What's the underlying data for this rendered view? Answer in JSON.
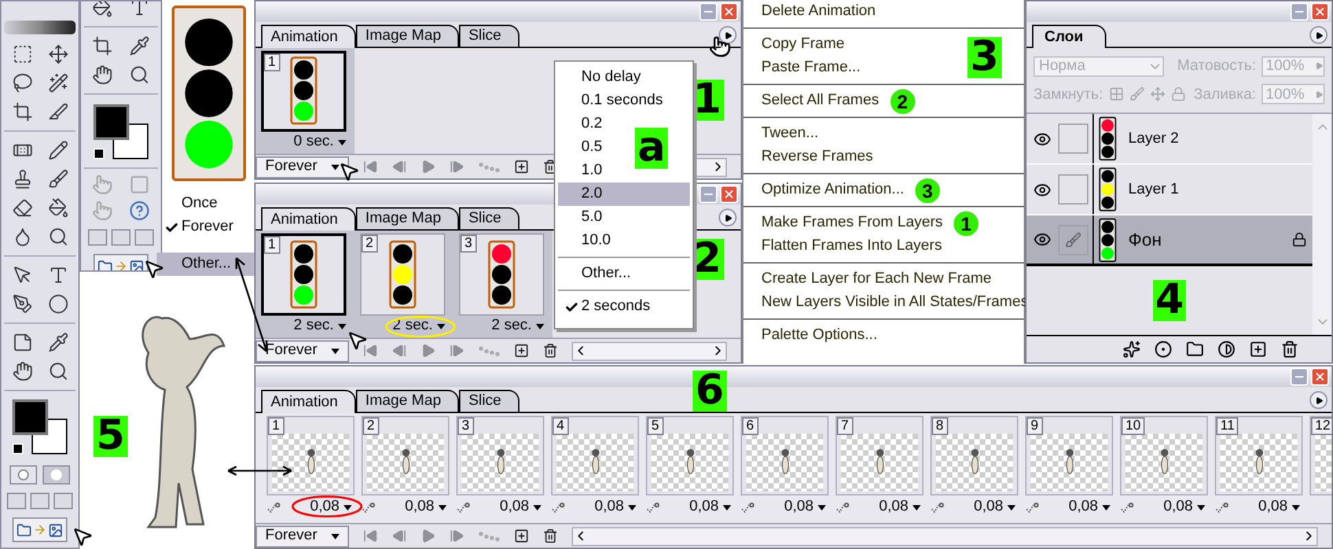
{
  "loop_menu": {
    "preview": {
      "lights": [
        {
          "color": "#000000"
        },
        {
          "color": "#000000"
        },
        {
          "color": "#00ff00"
        }
      ]
    },
    "items": [
      {
        "label": "Once",
        "checked": false,
        "selected": false
      },
      {
        "label": "Forever",
        "checked": true,
        "selected": false
      },
      {
        "label": "Other...",
        "checked": false,
        "selected": true
      }
    ]
  },
  "rabbit": {
    "callout": "5"
  },
  "animation_panels": [
    {
      "callout": "1",
      "loop": "Forever",
      "tabs": [
        {
          "label": "Animation",
          "selected": true
        },
        {
          "label": "Image Map",
          "selected": false
        },
        {
          "label": "Slice",
          "selected": false
        }
      ],
      "frames": [
        {
          "kind": "traffic_light",
          "number": "1",
          "delay": "0 sec.",
          "selected": true,
          "circled": false,
          "lights": [
            {
              "color": "#000000"
            },
            {
              "color": "#000000"
            },
            {
              "color": "#00ff00"
            }
          ]
        }
      ]
    },
    {
      "callout": "2",
      "loop": "Forever",
      "tabs": [
        {
          "label": "Animation",
          "selected": true
        },
        {
          "label": "Image Map",
          "selected": false
        },
        {
          "label": "Slice",
          "selected": false
        }
      ],
      "frames": [
        {
          "kind": "traffic_light",
          "number": "1",
          "delay": "2 sec.",
          "selected": true,
          "circled": false,
          "lights": [
            {
              "color": "#000000"
            },
            {
              "color": "#000000"
            },
            {
              "color": "#00ff00"
            }
          ]
        },
        {
          "kind": "traffic_light",
          "number": "2",
          "delay": "2 sec.",
          "selected": false,
          "circled": true,
          "lights": [
            {
              "color": "#000000"
            },
            {
              "color": "#ffff00"
            },
            {
              "color": "#000000"
            }
          ]
        },
        {
          "kind": "traffic_light",
          "number": "3",
          "delay": "2 sec.",
          "selected": false,
          "circled": false,
          "lights": [
            {
              "color": "#ff0033"
            },
            {
              "color": "#000000"
            },
            {
              "color": "#000000"
            }
          ]
        }
      ]
    },
    {
      "callout": "6",
      "loop": "Forever",
      "tabs": [
        {
          "label": "Animation",
          "selected": true
        },
        {
          "label": "Image Map",
          "selected": false
        },
        {
          "label": "Slice",
          "selected": false
        }
      ],
      "frames": [
        {
          "kind": "rabbit",
          "number": "1",
          "delay": "0,08",
          "selected": false,
          "circled": true
        },
        {
          "kind": "rabbit",
          "number": "2",
          "delay": "0,08",
          "selected": false,
          "circled": false
        },
        {
          "kind": "rabbit",
          "number": "3",
          "delay": "0,08",
          "selected": false,
          "circled": false
        },
        {
          "kind": "rabbit",
          "number": "4",
          "delay": "0,08",
          "selected": false,
          "circled": false
        },
        {
          "kind": "rabbit",
          "number": "5",
          "delay": "0,08",
          "selected": false,
          "circled": false
        },
        {
          "kind": "rabbit",
          "number": "6",
          "delay": "0,08",
          "selected": false,
          "circled": false
        },
        {
          "kind": "rabbit",
          "number": "7",
          "delay": "0,08",
          "selected": false,
          "circled": false
        },
        {
          "kind": "rabbit",
          "number": "8",
          "delay": "0,08",
          "selected": false,
          "circled": false
        },
        {
          "kind": "rabbit",
          "number": "9",
          "delay": "0,08",
          "selected": false,
          "circled": false
        },
        {
          "kind": "rabbit",
          "number": "10",
          "delay": "0,08",
          "selected": false,
          "circled": false
        },
        {
          "kind": "rabbit",
          "number": "11",
          "delay": "0,08",
          "selected": false,
          "circled": false
        },
        {
          "kind": "rabbit",
          "number": "12"
        }
      ]
    }
  ],
  "delay_menu": {
    "callout": "a",
    "groups": [
      [
        {
          "label": "No delay",
          "selected": false,
          "checked": false
        },
        {
          "label": "0.1 seconds",
          "selected": false,
          "checked": false
        },
        {
          "label": "0.2",
          "selected": false,
          "checked": false
        },
        {
          "label": "0.5",
          "selected": false,
          "checked": false
        },
        {
          "label": "1.0",
          "selected": false,
          "checked": false
        },
        {
          "label": "2.0",
          "selected": true,
          "checked": false
        },
        {
          "label": "5.0",
          "selected": false,
          "checked": false
        },
        {
          "label": "10.0",
          "selected": false,
          "checked": false
        }
      ],
      [
        {
          "label": "Other...",
          "selected": false,
          "checked": false
        }
      ],
      [
        {
          "label": "2 seconds",
          "selected": false,
          "checked": true
        }
      ]
    ]
  },
  "palette_menu": {
    "callout": "3",
    "groups": [
      [
        {
          "label": "Delete Animation"
        }
      ],
      [
        {
          "label": "Copy Frame"
        },
        {
          "label": "Paste Frame..."
        }
      ],
      [
        {
          "label": "Select All Frames",
          "badge": "2"
        }
      ],
      [
        {
          "label": "Tween..."
        },
        {
          "label": "Reverse Frames"
        }
      ],
      [
        {
          "label": "Optimize Animation...",
          "badge": "3"
        }
      ],
      [
        {
          "label": "Make Frames From Layers",
          "badge": "1"
        },
        {
          "label": "Flatten Frames Into Layers"
        }
      ],
      [
        {
          "label": "Create Layer for Each New Frame"
        },
        {
          "label": "New Layers Visible in All States/Frames"
        }
      ],
      [
        {
          "label": "Palette Options..."
        }
      ]
    ]
  },
  "layers_panel": {
    "callout": "4",
    "tab": "Слои",
    "blend_mode": "Норма",
    "opacity_label": "Матовость:",
    "opacity": "100%",
    "lock_label": "Замкнуть:",
    "fill_label": "Заливка:",
    "fill": "100%",
    "layers": [
      {
        "name": "Layer 2",
        "selected": false,
        "locked": false,
        "visible": true,
        "lights": [
          {
            "color": "#ff0033"
          },
          {
            "color": "#000000"
          },
          {
            "color": "#000000"
          }
        ]
      },
      {
        "name": "Layer 1",
        "selected": false,
        "locked": false,
        "visible": true,
        "lights": [
          {
            "color": "#000000"
          },
          {
            "color": "#ffff00"
          },
          {
            "color": "#000000"
          }
        ]
      },
      {
        "name": "Фон",
        "selected": true,
        "locked": true,
        "visible": true,
        "lights": [
          {
            "color": "#000000"
          },
          {
            "color": "#000000"
          },
          {
            "color": "#00ff00"
          }
        ]
      }
    ]
  }
}
